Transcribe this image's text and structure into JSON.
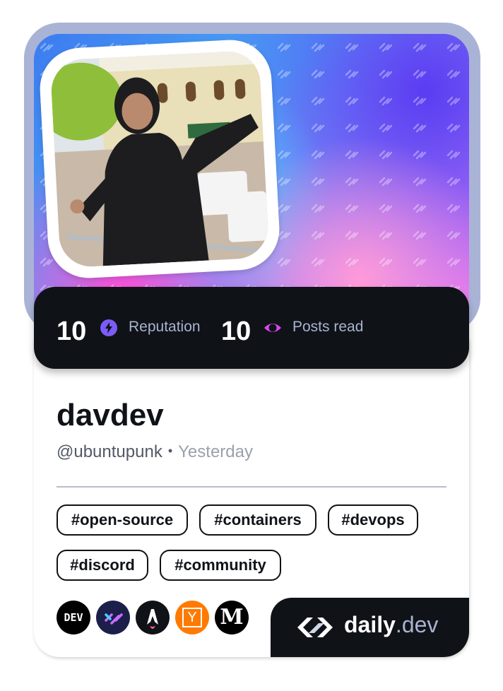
{
  "stats": {
    "reputation_value": "10",
    "reputation_label": "Reputation",
    "posts_value": "10",
    "posts_label": "Posts read"
  },
  "profile": {
    "name": "davdev",
    "handle": "@ubuntupunk",
    "dot": "•",
    "time": "Yesterday"
  },
  "tags": [
    "#open-source",
    "#containers",
    "#devops",
    "#discord",
    "#community"
  ],
  "sources": [
    {
      "icon": "dev-to-icon",
      "text": "DEV"
    },
    {
      "icon": "daily-dev-source-icon",
      "text": ""
    },
    {
      "icon": "astro-icon",
      "text": ""
    },
    {
      "icon": "hacker-news-icon",
      "text": "Y"
    },
    {
      "icon": "medium-icon",
      "text": "M"
    }
  ],
  "brand": {
    "name": "daily",
    "suffix": ".dev"
  },
  "colors": {
    "dark": "#0f1217",
    "reputation_icon": "#7b5cf5",
    "posts_icon": "#d946ef",
    "hacker_news": "#ff7a00"
  }
}
